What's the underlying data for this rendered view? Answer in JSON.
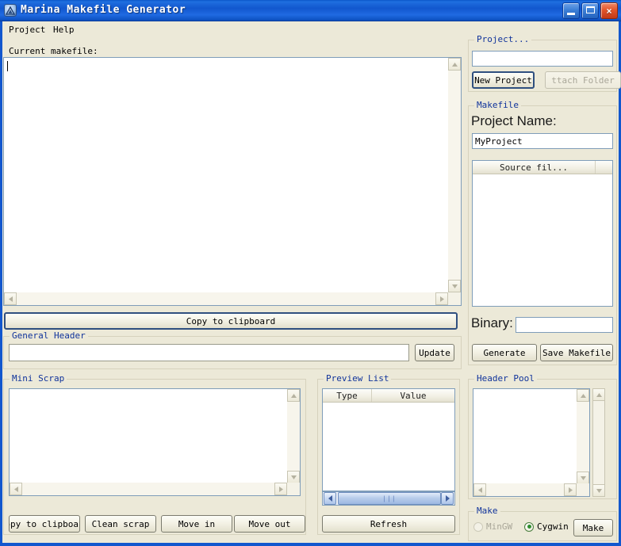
{
  "window": {
    "title": "Marina Makefile Generator",
    "icon": "app-logo-icon",
    "minimize_label": "Minimize",
    "maximize_label": "Maximize",
    "close_label": "×",
    "accent_titlebar": "#1257ce",
    "accent_groupbox_title": "#10339b",
    "face_color": "#ece9d8"
  },
  "menu": {
    "items": [
      {
        "label": "Project"
      },
      {
        "label": "Help"
      }
    ]
  },
  "main": {
    "current_makefile_label": "Current makefile:",
    "makefile_text": "",
    "copy_to_clipboard_label": "Copy to clipboard",
    "general_header": {
      "group_title": "General Header",
      "value": "",
      "placeholder": "",
      "update_label": "Update"
    },
    "mini_scrap": {
      "group_title": "Mini Scrap",
      "value": "",
      "buttons": [
        {
          "label": "Copy to clipboard",
          "truncated_label": "opy to clipboar"
        },
        {
          "label": "Clean scrap"
        },
        {
          "label": "Move in"
        },
        {
          "label": "Move out"
        }
      ]
    },
    "preview_list": {
      "group_title": "Preview List",
      "columns": [
        "Type",
        "Value"
      ],
      "rows": [],
      "refresh_label": "Refresh"
    }
  },
  "sidebar": {
    "project_group": {
      "group_title": "Project...",
      "path_value": "",
      "path_placeholder": "",
      "new_project_label": "New Project",
      "attach_folder_label": "Attach Folder",
      "attach_folder_truncated": "ttach Folder",
      "attach_folder_enabled": false
    },
    "makefile_group": {
      "group_title": "Makefile",
      "project_name_label": "Project Name:",
      "project_name_value": "MyProject",
      "source_files": {
        "column_label": "Source fil...",
        "rows": []
      },
      "binary_label": "Binary:",
      "binary_value": "",
      "generate_label": "Generate",
      "save_makefile_label": "Save Makefile"
    },
    "header_pool": {
      "group_title": "Header Pool",
      "value": ""
    },
    "make_group": {
      "group_title": "Make",
      "options": [
        {
          "label": "MinGW",
          "selected": false,
          "enabled": false
        },
        {
          "label": "Cygwin",
          "selected": true,
          "enabled": true
        }
      ],
      "make_label": "Make"
    }
  }
}
